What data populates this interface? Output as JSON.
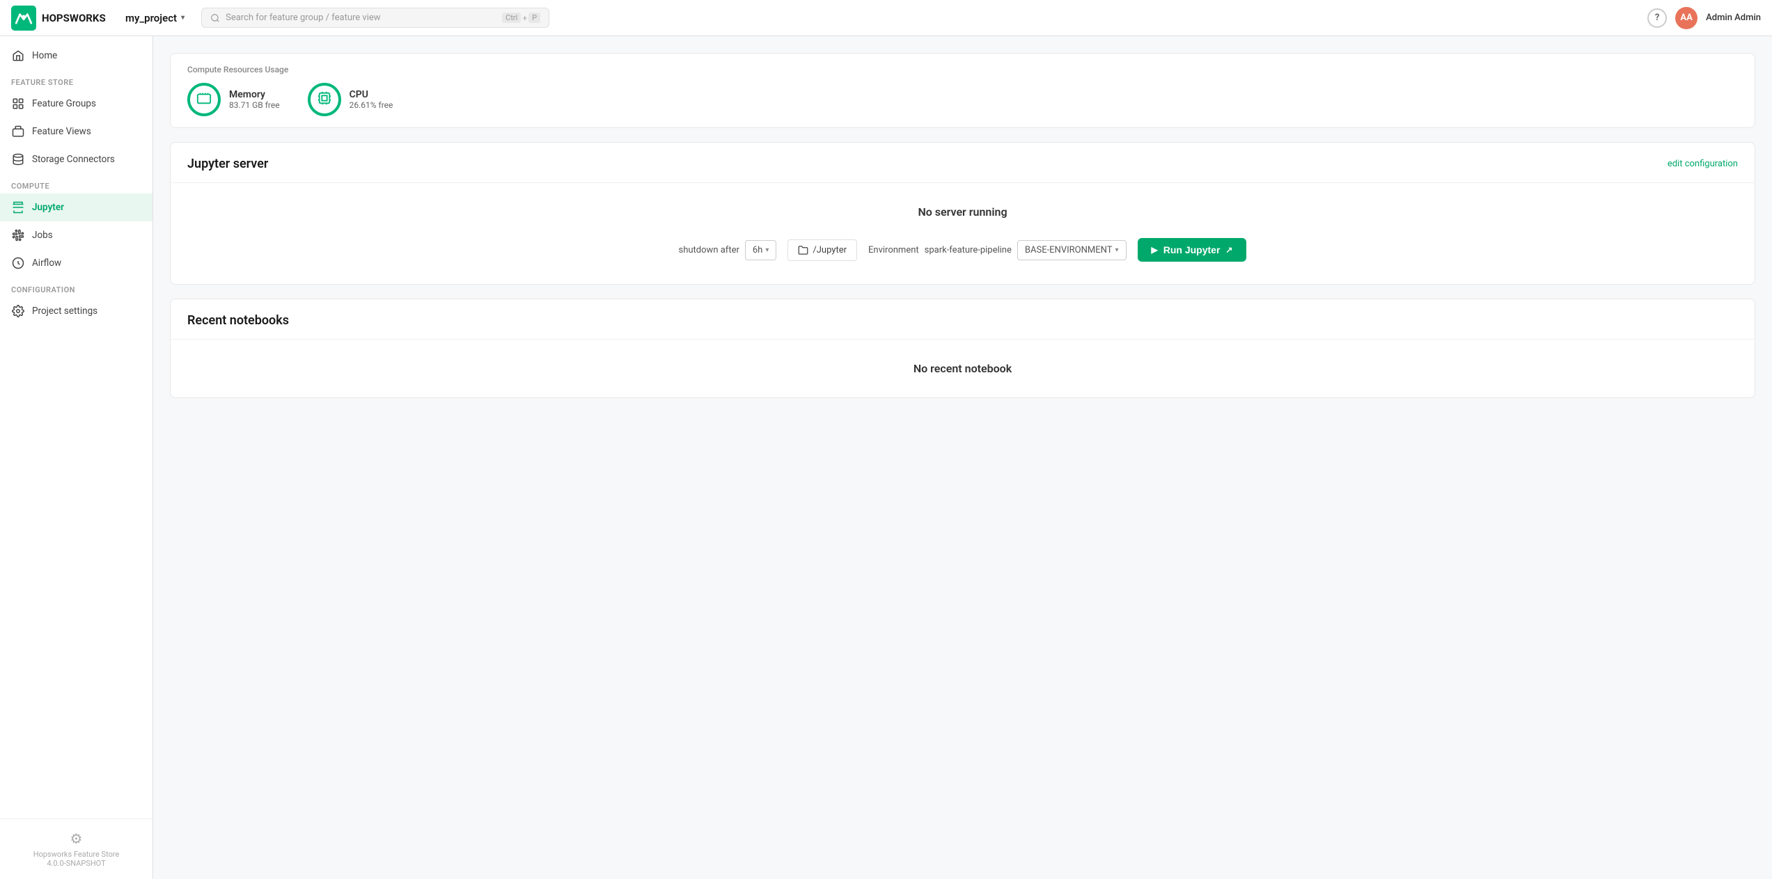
{
  "topBar": {
    "logoText": "HOPSWORKS",
    "projectName": "my_project",
    "searchPlaceholder": "Search for feature group / feature view",
    "searchShortcut": [
      "Ctrl",
      "+",
      "P"
    ],
    "helpLabel": "?",
    "adminInitials": "AA",
    "adminName": "Admin Admin"
  },
  "sidebar": {
    "sections": [
      {
        "label": "",
        "items": [
          {
            "id": "home",
            "label": "Home",
            "icon": "home-icon",
            "active": false
          }
        ]
      },
      {
        "label": "Feature Store",
        "items": [
          {
            "id": "feature-groups",
            "label": "Feature Groups",
            "icon": "feature-groups-icon",
            "active": false
          },
          {
            "id": "feature-views",
            "label": "Feature Views",
            "icon": "feature-views-icon",
            "active": false
          },
          {
            "id": "storage-connectors",
            "label": "Storage Connectors",
            "icon": "storage-connectors-icon",
            "active": false
          }
        ]
      },
      {
        "label": "Compute",
        "items": [
          {
            "id": "jupyter",
            "label": "Jupyter",
            "icon": "jupyter-icon",
            "active": true
          },
          {
            "id": "jobs",
            "label": "Jobs",
            "icon": "jobs-icon",
            "active": false
          },
          {
            "id": "airflow",
            "label": "Airflow",
            "icon": "airflow-icon",
            "active": false
          }
        ]
      },
      {
        "label": "Configuration",
        "items": [
          {
            "id": "project-settings",
            "label": "Project settings",
            "icon": "settings-icon",
            "active": false
          }
        ]
      }
    ],
    "bottomText": "Hopsworks Feature Store",
    "bottomVersion": "4.0.0-SNAPSHOT"
  },
  "computeResources": {
    "title": "Compute Resources Usage",
    "memory": {
      "label": "Memory",
      "value": "83.71 GB free"
    },
    "cpu": {
      "label": "CPU",
      "value": "26.61% free"
    }
  },
  "jupyterServer": {
    "title": "Jupyter server",
    "editConfigLabel": "edit configuration",
    "noServerMsg": "No server running",
    "shutdownLabel": "shutdown after",
    "shutdownValue": "6h",
    "folderLabel": "/Jupyter",
    "environmentLabel": "Environment",
    "environmentName": "spark-feature-pipeline",
    "environmentSelect": "BASE-ENVIRONMENT",
    "runButtonLabel": "Run Jupyter"
  },
  "recentNotebooks": {
    "title": "Recent notebooks",
    "noNotebooksMsg": "No recent notebook"
  }
}
